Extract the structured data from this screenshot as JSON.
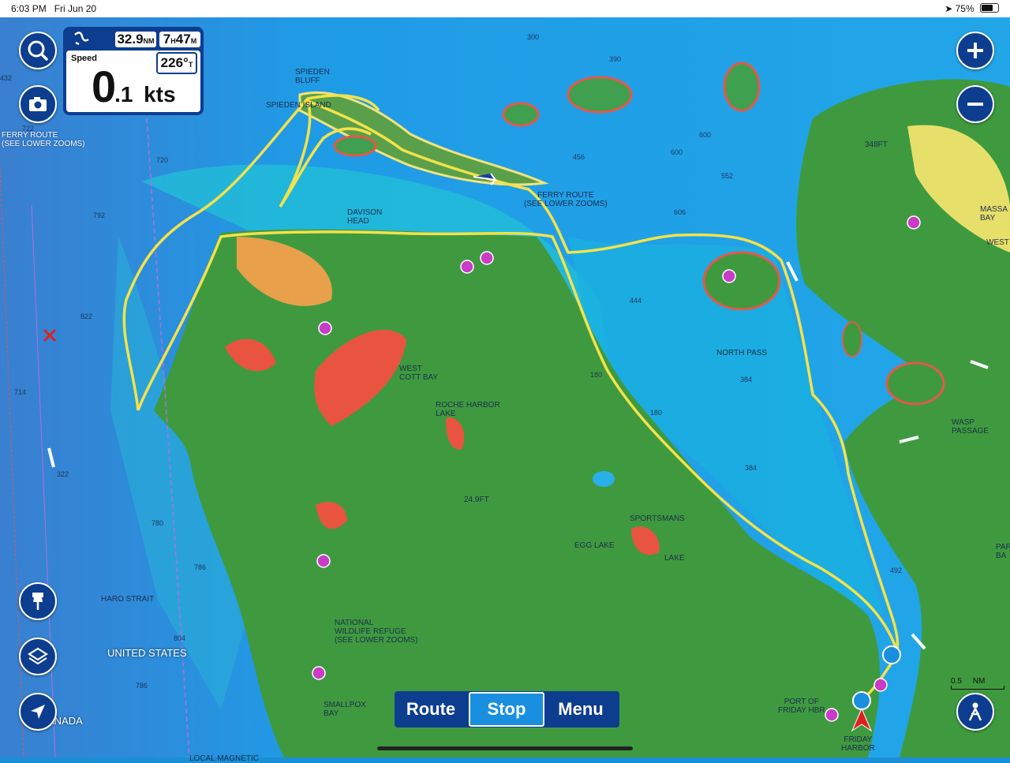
{
  "status": {
    "time": "6:03 PM",
    "date": "Fri Jun 20",
    "battery": "75%",
    "battery_level": 0.75
  },
  "infobox": {
    "dist_val": "32.9",
    "dist_unit": "NM",
    "eta_h": "7",
    "eta_m": "47",
    "eta_h_unit": "H",
    "eta_m_unit": "M",
    "speed_label": "Speed",
    "speed_int": "0",
    "speed_dec": ".1",
    "speed_unit": "kts",
    "heading": "226°",
    "heading_ref": "T"
  },
  "buttons": {
    "search_icon": "search-icon",
    "camera_icon": "camera-icon",
    "zoom_in_icon": "plus-icon",
    "zoom_out_icon": "minus-icon",
    "pin_icon": "pin-icon",
    "layers_icon": "layers-icon",
    "locate_icon": "location-arrow-icon",
    "person_icon": "person-icon"
  },
  "bottom_menu": {
    "route": "Route",
    "stop": "Stop",
    "menu": "Menu"
  },
  "scale": {
    "value": "0.5",
    "unit": "NM"
  },
  "labels": {
    "spieden_bluff": "SPIEDEN\nBLUFF",
    "spieden_island": "SPIEDEN ISLAND",
    "ferry_route_left": "FERRY ROUTE\n(SEE LOWER ZOOMS)",
    "ferry_route_mid": "FERRY ROUTE\n(SEE LOWER ZOOMS)",
    "davison_head": "DAVISON\nHEAD",
    "west_cott_bay": "WEST\nCOTT BAY",
    "roche_harbor_lake": "ROCHE HARBOR\nLAKE",
    "north_pass": "NORTH PASS",
    "wasp_passage": "WASP\nPASSAGE",
    "sportsmans": "SPORTSMANS",
    "egg_lake": "EGG LAKE",
    "lake": "LAKE",
    "haro_strait": "HARO STRAIT",
    "united_states": "UNITED STATES",
    "canada": "ANADA",
    "nwr": "NATIONAL\nWILDLIFE REFUGE\n(SEE LOWER ZOOMS)",
    "smallpox_bay": "SMALLPOX\nBAY",
    "port_of_friday": "PORT OF\nFRIDAY HBR",
    "friday_harbor": "FRIDAY\nHARBOR",
    "massacre_bay": "MASSA\nBAY",
    "west": "WEST",
    "park": "PAR\nBA",
    "local_magnetic": "LOCAL MAGNETIC",
    "elev_348": "348FT",
    "elev_249": "24.9FT"
  },
  "depths": [
    "300",
    "390",
    "600",
    "456",
    "600",
    "552",
    "606",
    "720",
    "792",
    "822",
    "714",
    "322",
    "780",
    "786",
    "804",
    "786",
    "444",
    "384",
    "180",
    "180",
    "384",
    "492",
    "432",
    "722"
  ]
}
